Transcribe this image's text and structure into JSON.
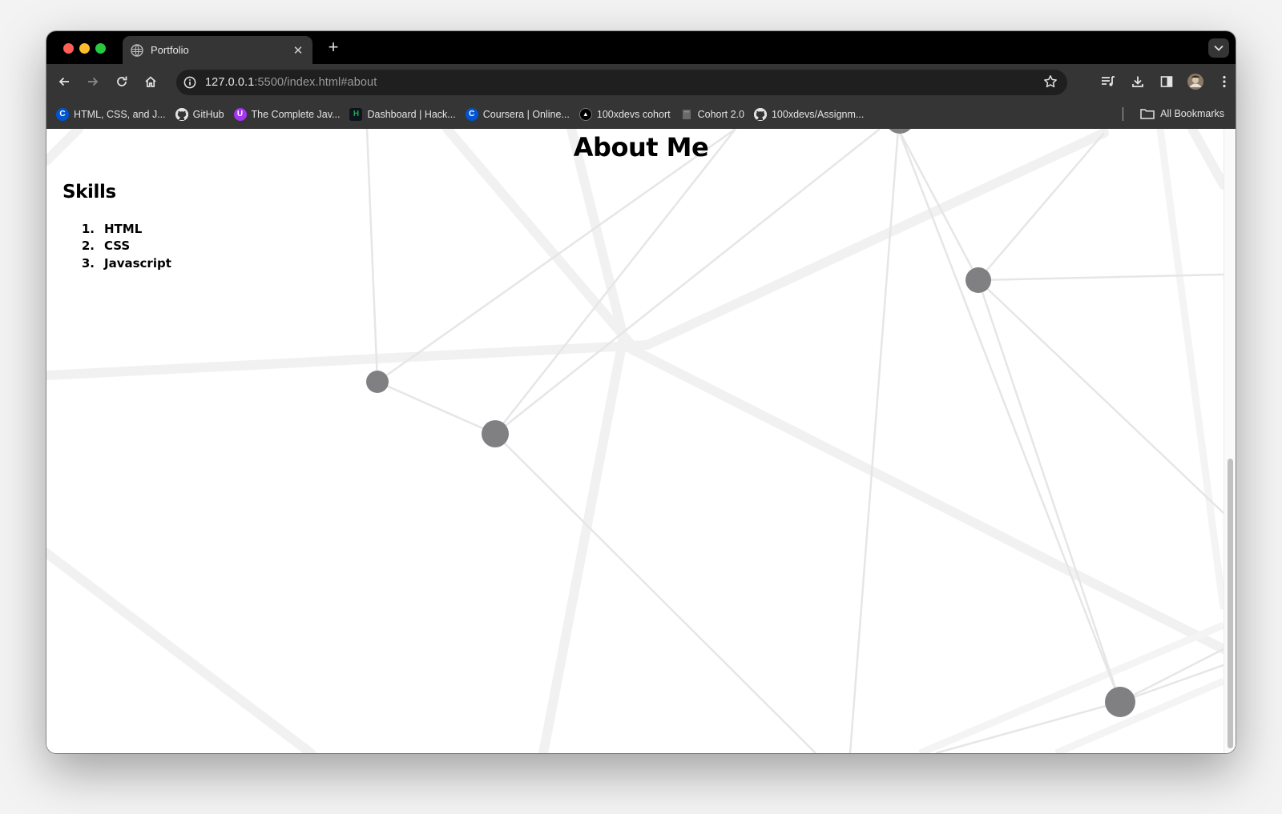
{
  "tab": {
    "title": "Portfolio",
    "close_icon": "close-icon",
    "new_tab_icon": "plus-icon"
  },
  "address_bar": {
    "url_host": "127.0.0.1",
    "url_rest": ":5500/index.html#about"
  },
  "bookmarks": [
    {
      "label": "HTML, CSS, and J...",
      "icon": "coursera-icon",
      "color": "#0056d2",
      "glyph": "C"
    },
    {
      "label": "GitHub",
      "icon": "github-icon",
      "color": "#ffffff",
      "glyph": ""
    },
    {
      "label": "The Complete Jav...",
      "icon": "udemy-icon",
      "color": "#a435f0",
      "glyph": "U"
    },
    {
      "label": "Dashboard | Hack...",
      "icon": "hackerrank-icon",
      "color": "#1ba94c",
      "glyph": "H"
    },
    {
      "label": "Coursera | Online...",
      "icon": "coursera-icon",
      "color": "#0056d2",
      "glyph": "C"
    },
    {
      "label": "100xdevs cohort",
      "icon": "triangle-icon",
      "color": "#000000",
      "glyph": "▲"
    },
    {
      "label": "Cohort 2.0",
      "icon": "page-icon",
      "color": "#5f5f5f",
      "glyph": ""
    },
    {
      "label": "100xdevs/Assignm...",
      "icon": "github-icon",
      "color": "#ffffff",
      "glyph": ""
    }
  ],
  "all_bookmarks_label": "All Bookmarks",
  "page": {
    "title": "About Me",
    "skills_heading": "Skills",
    "skills": [
      {
        "num": "1.",
        "label": "HTML"
      },
      {
        "num": "2.",
        "label": "CSS"
      },
      {
        "num": "3.",
        "label": "Javascript"
      }
    ]
  },
  "colors": {
    "chrome_dark": "#353535",
    "tab_strip": "#000000",
    "omnibox": "#1f1f1f",
    "node_fill": "#808083",
    "network_line": "#ebebeb"
  }
}
